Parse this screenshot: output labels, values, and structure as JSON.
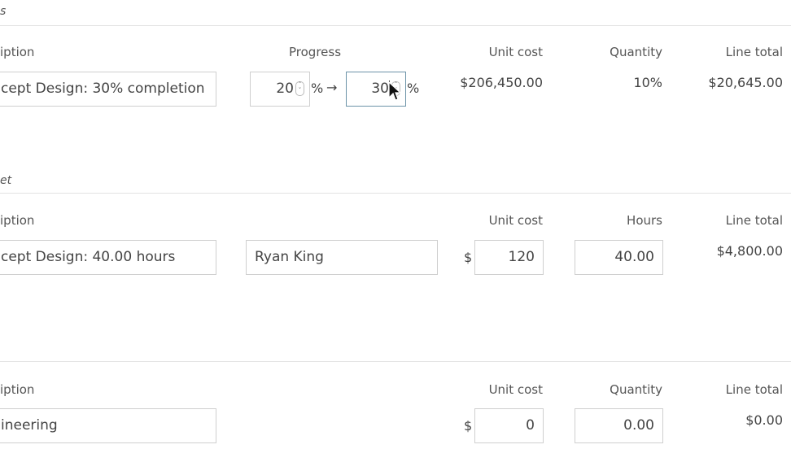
{
  "sections": [
    {
      "header": "s",
      "labels": {
        "description": "iption",
        "progress": "Progress",
        "unit_cost": "Unit cost",
        "quantity": "Quantity",
        "line_total": "Line total"
      },
      "description": "cept Design: 30% completion",
      "progress_from": "20",
      "progress_to": "30",
      "percent": "%",
      "arrow": "→",
      "unit_cost": "$206,450.00",
      "quantity": "10%",
      "line_total": "$20,645.00"
    },
    {
      "header": "et",
      "labels": {
        "description": "iption",
        "unit_cost": "Unit cost",
        "hours": "Hours",
        "line_total": "Line total"
      },
      "description": "cept Design: 40.00 hours",
      "person": "Ryan King",
      "currency": "$",
      "unit_cost": "120",
      "hours": "40.00",
      "line_total": "$4,800.00"
    },
    {
      "labels": {
        "description": "iption",
        "unit_cost": "Unit cost",
        "quantity": "Quantity",
        "line_total": "Line total"
      },
      "description": "ineering",
      "currency": "$",
      "unit_cost": "0",
      "quantity": "0.00",
      "line_total": "$0.00"
    }
  ]
}
